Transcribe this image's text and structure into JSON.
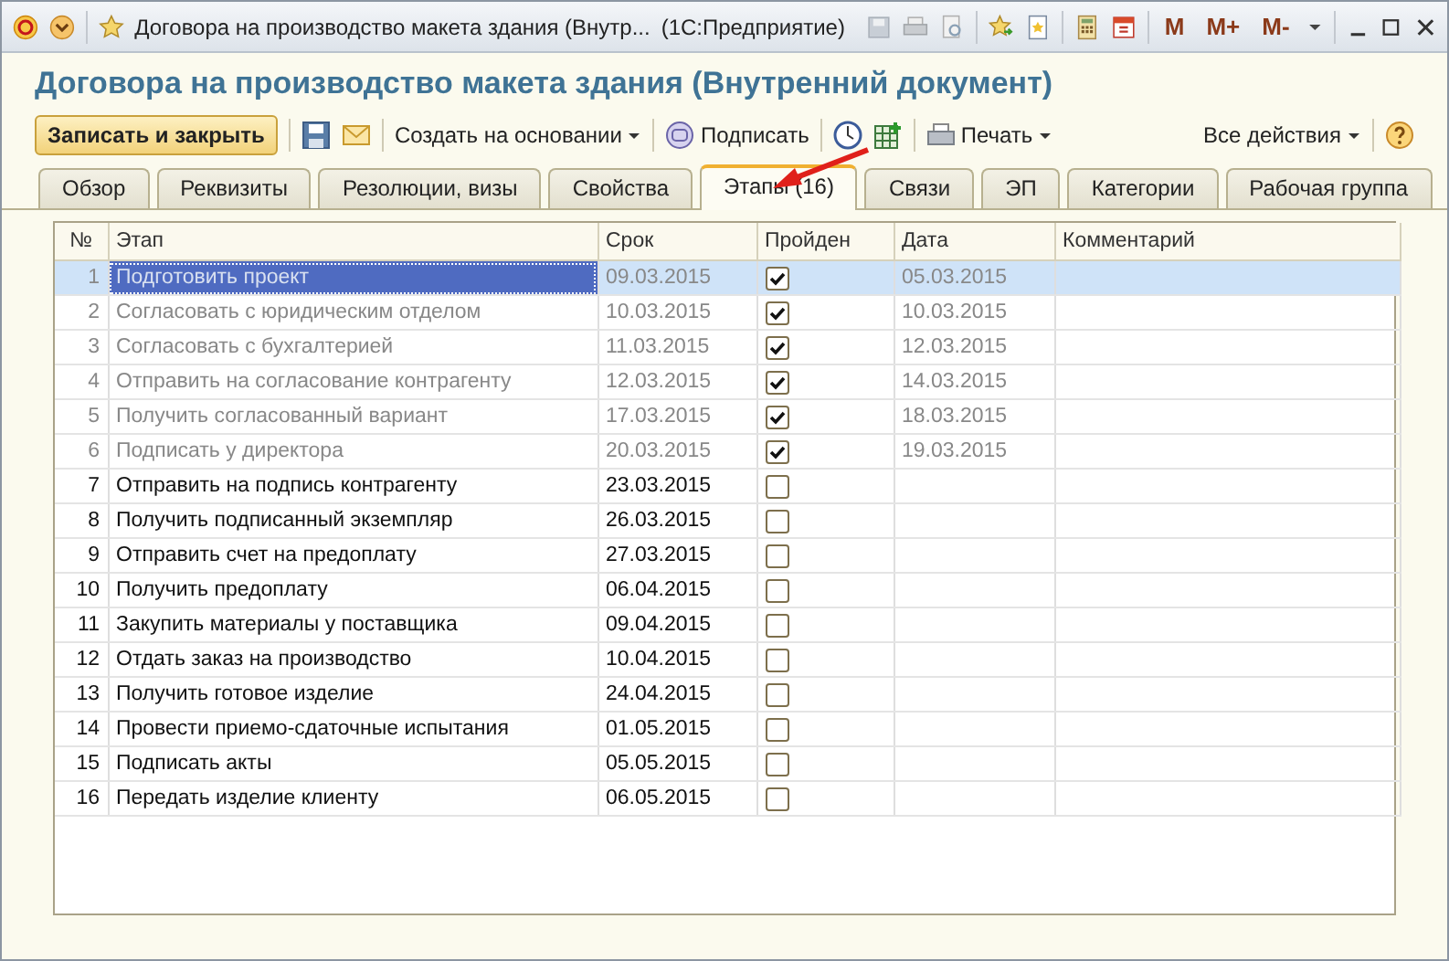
{
  "title_bar": {
    "title": "Договора на производство макета здания (Внутр...",
    "app": "(1С:Предприятие)",
    "memory_buttons": [
      "M",
      "M+",
      "M-"
    ]
  },
  "heading": "Договора на производство макета здания (Внутренний документ)",
  "toolbar": {
    "save_close": "Записать и закрыть",
    "create_based_on": "Создать на основании",
    "sign": "Подписать",
    "print": "Печать",
    "all_actions": "Все действия"
  },
  "tabs": [
    {
      "label": "Обзор",
      "selected": false
    },
    {
      "label": "Реквизиты",
      "selected": false
    },
    {
      "label": "Резолюции, визы",
      "selected": false
    },
    {
      "label": "Свойства",
      "selected": false
    },
    {
      "label": "Этапы (16)",
      "selected": true
    },
    {
      "label": "Связи",
      "selected": false
    },
    {
      "label": "ЭП",
      "selected": false
    },
    {
      "label": "Категории",
      "selected": false
    },
    {
      "label": "Рабочая группа",
      "selected": false
    }
  ],
  "table": {
    "columns": [
      "№",
      "Этап",
      "Срок",
      "Пройден",
      "Дата",
      "Комментарий"
    ],
    "rows": [
      {
        "n": "1",
        "stage": "Подготовить проект",
        "due": "09.03.2015",
        "passed": true,
        "date": "05.03.2015",
        "selected": true
      },
      {
        "n": "2",
        "stage": "Согласовать с юридическим отделом",
        "due": "10.03.2015",
        "passed": true,
        "date": "10.03.2015",
        "selected": false
      },
      {
        "n": "3",
        "stage": "Согласовать с бухгалтерией",
        "due": "11.03.2015",
        "passed": true,
        "date": "12.03.2015",
        "selected": false
      },
      {
        "n": "4",
        "stage": "Отправить на согласование контрагенту",
        "due": "12.03.2015",
        "passed": true,
        "date": "14.03.2015",
        "selected": false
      },
      {
        "n": "5",
        "stage": "Получить согласованный вариант",
        "due": "17.03.2015",
        "passed": true,
        "date": "18.03.2015",
        "selected": false
      },
      {
        "n": "6",
        "stage": "Подписать у директора",
        "due": "20.03.2015",
        "passed": true,
        "date": "19.03.2015",
        "selected": false
      },
      {
        "n": "7",
        "stage": "Отправить на подпись контрагенту",
        "due": "23.03.2015",
        "passed": false,
        "selected": false
      },
      {
        "n": "8",
        "stage": "Получить подписанный экземпляр",
        "due": "26.03.2015",
        "passed": false,
        "selected": false
      },
      {
        "n": "9",
        "stage": "Отправить счет на предоплату",
        "due": "27.03.2015",
        "passed": false,
        "selected": false
      },
      {
        "n": "10",
        "stage": "Получить предоплату",
        "due": "06.04.2015",
        "passed": false,
        "selected": false
      },
      {
        "n": "11",
        "stage": "Закупить материалы у поставщика",
        "due": "09.04.2015",
        "passed": false,
        "selected": false
      },
      {
        "n": "12",
        "stage": "Отдать заказ на производство",
        "due": "10.04.2015",
        "passed": false,
        "selected": false
      },
      {
        "n": "13",
        "stage": "Получить готовое изделие",
        "due": "24.04.2015",
        "passed": false,
        "selected": false
      },
      {
        "n": "14",
        "stage": "Провести приемо-сдаточные испытания",
        "due": "01.05.2015",
        "passed": false,
        "selected": false
      },
      {
        "n": "15",
        "stage": "Подписать акты",
        "due": "05.05.2015",
        "passed": false,
        "selected": false
      },
      {
        "n": "16",
        "stage": "Передать изделие клиенту",
        "due": "06.05.2015",
        "passed": false,
        "selected": false
      }
    ]
  }
}
